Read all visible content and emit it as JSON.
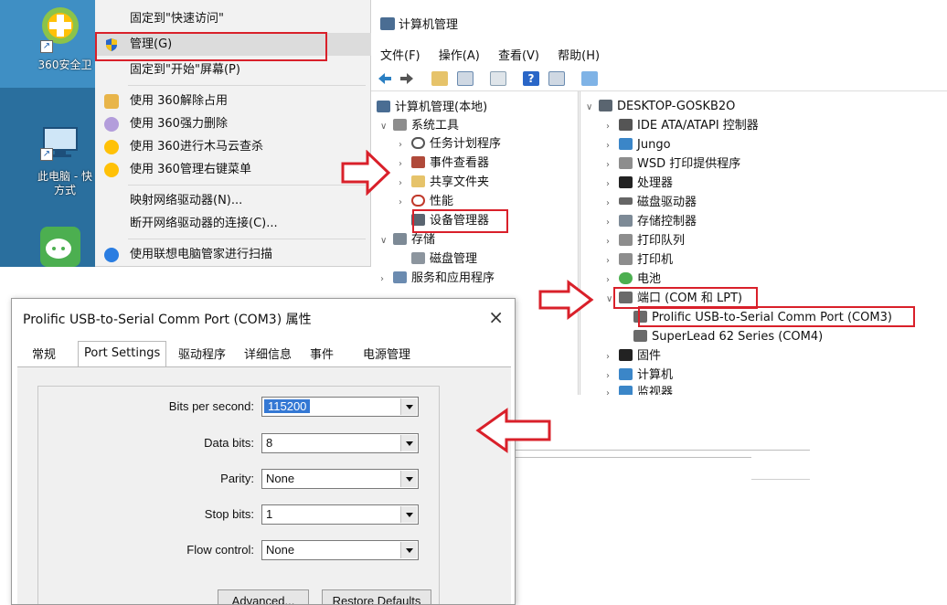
{
  "desktop": {
    "icons": [
      {
        "label": "360安全卫",
        "icon": "360-security-icon"
      },
      {
        "label": "此电脑 - 快\n方式",
        "icon": "computer-icon"
      },
      {
        "label": "",
        "icon": "wechat-icon"
      }
    ]
  },
  "context_menu": {
    "items": [
      {
        "label": "固定到\"快速访问\"",
        "icon": ""
      },
      {
        "label": "管理(G)",
        "icon": "shield-icon"
      },
      {
        "label": "固定到\"开始\"屏幕(P)",
        "icon": ""
      },
      {
        "label": "使用 360解除占用",
        "icon": "360-unlock-icon"
      },
      {
        "label": "使用 360强力删除",
        "icon": "360-delete-icon"
      },
      {
        "label": "使用 360进行木马云查杀",
        "icon": "360-scan-icon"
      },
      {
        "label": "使用 360管理右键菜单",
        "icon": "360-menu-icon"
      },
      {
        "label": "映射网络驱动器(N)...",
        "icon": ""
      },
      {
        "label": "断开网络驱动器的连接(C)...",
        "icon": ""
      },
      {
        "label": "使用联想电脑管家进行扫描",
        "icon": "lenovo-scan-icon"
      }
    ]
  },
  "computer_management": {
    "title": "计算机管理",
    "menu": [
      "文件(F)",
      "操作(A)",
      "查看(V)",
      "帮助(H)"
    ],
    "tree": [
      {
        "label": "计算机管理(本地)",
        "twisty": ""
      },
      {
        "label": "系统工具",
        "twisty": "∨"
      },
      {
        "label": "任务计划程序",
        "twisty": "›"
      },
      {
        "label": "事件查看器",
        "twisty": "›"
      },
      {
        "label": "共享文件夹",
        "twisty": "›"
      },
      {
        "label": "性能",
        "twisty": "›"
      },
      {
        "label": "设备管理器",
        "twisty": ""
      },
      {
        "label": "存储",
        "twisty": "∨"
      },
      {
        "label": "磁盘管理",
        "twisty": ""
      },
      {
        "label": "服务和应用程序",
        "twisty": "›"
      }
    ],
    "devices": [
      {
        "label": "DESKTOP-GOSKB2O",
        "twisty": "∨"
      },
      {
        "label": "IDE ATA/ATAPI 控制器",
        "twisty": "›"
      },
      {
        "label": "Jungo",
        "twisty": "›"
      },
      {
        "label": "WSD 打印提供程序",
        "twisty": "›"
      },
      {
        "label": "处理器",
        "twisty": "›"
      },
      {
        "label": "磁盘驱动器",
        "twisty": "›"
      },
      {
        "label": "存储控制器",
        "twisty": "›"
      },
      {
        "label": "打印队列",
        "twisty": "›"
      },
      {
        "label": "打印机",
        "twisty": "›"
      },
      {
        "label": "电池",
        "twisty": "›"
      },
      {
        "label": "端口 (COM 和 LPT)",
        "twisty": "∨"
      },
      {
        "label": "Prolific USB-to-Serial Comm Port (COM3)",
        "twisty": ""
      },
      {
        "label": "SuperLead 62 Series (COM4)",
        "twisty": ""
      },
      {
        "label": "固件",
        "twisty": "›"
      },
      {
        "label": "计算机",
        "twisty": "›"
      },
      {
        "label": "监视器",
        "twisty": "›"
      }
    ]
  },
  "properties_dialog": {
    "title": "Prolific USB-to-Serial Comm Port (COM3) 属性",
    "close": "×",
    "tabs": [
      "常规",
      "Port Settings",
      "驱动程序",
      "详细信息",
      "事件",
      "电源管理"
    ],
    "active_tab": "Port Settings",
    "fields": [
      {
        "label": "Bits per second:",
        "value": "115200"
      },
      {
        "label": "Data bits:",
        "value": "8"
      },
      {
        "label": "Parity:",
        "value": "None"
      },
      {
        "label": "Stop bits:",
        "value": "1"
      },
      {
        "label": "Flow control:",
        "value": "None"
      }
    ],
    "buttons": {
      "advanced": "Advanced...",
      "restore": "Restore Defaults"
    }
  },
  "colors": {
    "highlight_red": "#d9202a",
    "selection_blue": "#3478d4"
  }
}
